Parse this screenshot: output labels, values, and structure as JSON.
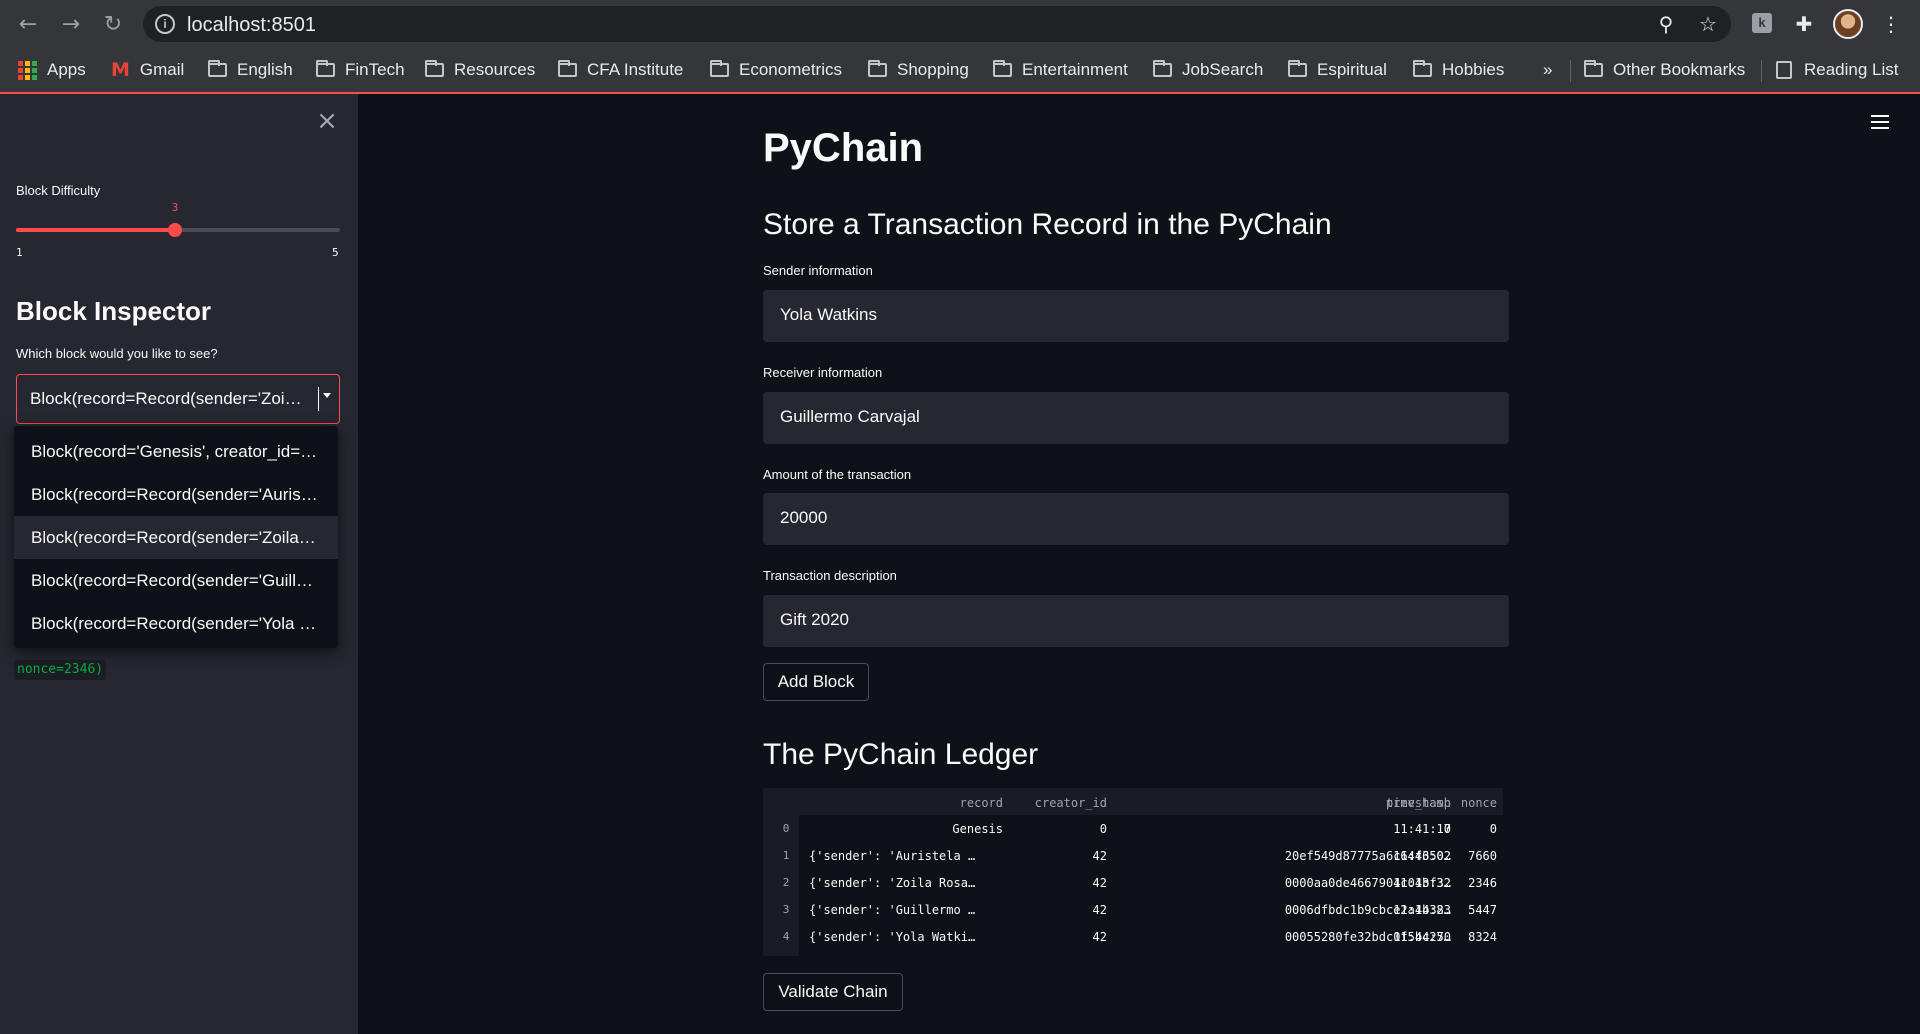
{
  "browser": {
    "url": "localhost:8501",
    "bookmarks": [
      "Apps",
      "Gmail",
      "English",
      "FinTech",
      "Resources",
      "CFA Institute",
      "Econometrics",
      "Shopping",
      "Entertainment",
      "JobSearch",
      "Espiritual",
      "Hobbies"
    ],
    "overflow_label": "»",
    "other_bookmarks": "Other Bookmarks",
    "reading_list": "Reading List",
    "icons": [
      "back-arrow-icon",
      "forward-arrow-icon",
      "reload-icon",
      "info-icon",
      "zoom-icon",
      "star-icon",
      "extension-icon",
      "puzzle-icon",
      "profile-avatar",
      "kebab-menu-icon"
    ]
  },
  "sidebar": {
    "slider": {
      "label": "Block Difficulty",
      "min": 1,
      "max": 5,
      "value": 3,
      "min_label": "1",
      "max_label": "5",
      "value_label": "3",
      "accent_color": "#ff4b4b"
    },
    "inspector_title": "Block Inspector",
    "select_label": "Which block would you like to see?",
    "selected_value": "Block(record=Record(sender='Zoi…",
    "options": [
      "Block(record='Genesis', creator_id=…",
      "Block(record=Record(sender='Auris…",
      "Block(record=Record(sender='Zoila…",
      "Block(record=Record(sender='Guill…",
      "Block(record=Record(sender='Yola …"
    ],
    "code_snippet": "nonce=2346)"
  },
  "main": {
    "title": "PyChain",
    "form_title": "Store a Transaction Record in the PyChain",
    "fields": [
      {
        "label": "Sender information",
        "value": "Yola Watkins"
      },
      {
        "label": "Receiver information",
        "value": "Guillermo Carvajal"
      },
      {
        "label": "Amount of the transaction",
        "value": "20000"
      },
      {
        "label": "Transaction description",
        "value": "Gift 2020"
      }
    ],
    "add_button": "Add Block",
    "ledger_title": "The PyChain Ledger",
    "ledger": {
      "columns": [
        "record",
        "creator_id",
        "prev_hash",
        "timestamp",
        "nonce"
      ],
      "rows": [
        {
          "index": "0",
          "record": "Genesis",
          "creator_id": "0",
          "prev_hash": "0",
          "timestamp": "11:41:17",
          "nonce": "0"
        },
        {
          "index": "1",
          "record": "{'sender': 'Auristela …",
          "creator_id": "42",
          "prev_hash": "20ef549d87775a6c64f650…",
          "timestamp": "11:43:02",
          "nonce": "7660"
        },
        {
          "index": "2",
          "record": "{'sender': 'Zoila Rosa…",
          "creator_id": "42",
          "prev_hash": "0000aa0de4667904c01bf3…",
          "timestamp": "11:43:32",
          "nonce": "2346"
        },
        {
          "index": "3",
          "record": "{'sender': 'Guillermo …",
          "creator_id": "42",
          "prev_hash": "0006dfbdc1b9cbce2a1b38…",
          "timestamp": "11:44:23",
          "nonce": "5447"
        },
        {
          "index": "4",
          "record": "{'sender': 'Yola Watki…",
          "creator_id": "42",
          "prev_hash": "00055280fe32bdc0f5bc27…",
          "timestamp": "11:44:50",
          "nonce": "8324"
        }
      ]
    },
    "validate_button": "Validate Chain"
  }
}
